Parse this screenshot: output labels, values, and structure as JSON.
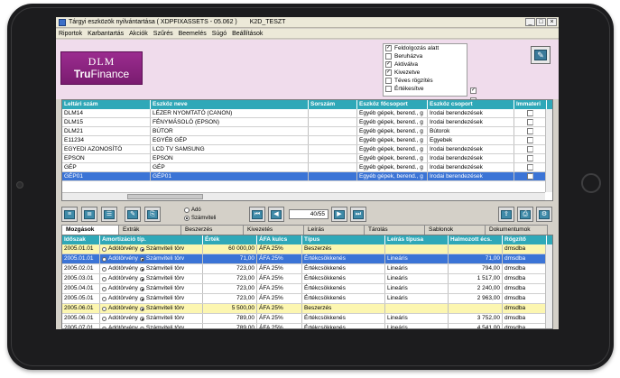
{
  "window": {
    "title": "Tárgyi eszközök nyilvántartása ( XDPFIXASSETS - 05.062 )",
    "user": "K2D_TESZT",
    "minimize": "_",
    "maximize": "□",
    "close": "×"
  },
  "menu": [
    "Riportok",
    "Karbantartás",
    "Akciók",
    "Szűrés",
    "Beemelés",
    "Súgó",
    "Beállítások"
  ],
  "logo": {
    "line1": "DLM",
    "line2a": "Tru",
    "line2b": "Finance"
  },
  "status_checks": [
    {
      "label": "Feldolgozás alatt",
      "checked": true
    },
    {
      "label": "Beruházva",
      "checked": false
    },
    {
      "label": "Aktiválva",
      "checked": true
    },
    {
      "label": "Kivezetve",
      "checked": true
    },
    {
      "label": "Téves rögzítés",
      "checked": false
    },
    {
      "label": "Értékesítve",
      "checked": false
    }
  ],
  "side_checks": [
    {
      "checked": true
    },
    {
      "checked": false
    }
  ],
  "assets_grid": {
    "columns": [
      "Leltári szám",
      "Eszköz neve",
      "Sorszám",
      "Eszköz főcsoport",
      "Eszköz csoport",
      "Immateri"
    ],
    "rows": [
      {
        "inv": "DLM14",
        "name": "LÉZER NYOMTATÓ (CANON)",
        "seq": "",
        "main": "Egyéb gépek, berend., g",
        "group": "Irodai berendezések",
        "imm": false
      },
      {
        "inv": "DLM15",
        "name": "FÉNYMÁSOLÓ (EPSON)",
        "seq": "",
        "main": "Egyéb gépek, berend., g",
        "group": "Irodai berendezések",
        "imm": false
      },
      {
        "inv": "DLM21",
        "name": "BÚTOR",
        "seq": "",
        "main": "Egyéb gépek, berend., g",
        "group": "Bútorok",
        "imm": false
      },
      {
        "inv": "E11234",
        "name": "EGYÉB GÉP",
        "seq": "",
        "main": "Egyéb gépek, berend., g",
        "group": "Egyebek",
        "imm": false
      },
      {
        "inv": "EGYEDI AZONOSÍTÓ",
        "name": "LCD TV SAMSUNG",
        "seq": "",
        "main": "Egyéb gépek, berend., g",
        "group": "Irodai berendezések",
        "imm": false
      },
      {
        "inv": "EPSON",
        "name": "EPSON",
        "seq": "",
        "main": "Egyéb gépek, berend., g",
        "group": "Irodai berendezések",
        "imm": false
      },
      {
        "inv": "GÉP",
        "name": "GÉP",
        "seq": "",
        "main": "Egyéb gépek, berend., g",
        "group": "Irodai berendezések",
        "imm": false
      },
      {
        "inv": "GÉP01",
        "name": "GÉP01",
        "seq": "",
        "main": "Egyéb gépek, berend., g",
        "group": "Irodai berendezések",
        "imm": false,
        "selected": true
      }
    ]
  },
  "radio_mode": {
    "options": [
      "Adó",
      "Számviteli"
    ],
    "selected": 1
  },
  "nav": {
    "counter": "40/55"
  },
  "tabs": [
    "Mozgások",
    "Extrák",
    "Beszerzés",
    "Kivezetés",
    "Leírás",
    "Tárolás",
    "Sablonok",
    "Dokumentumok"
  ],
  "movements_grid": {
    "columns": [
      "Időszak",
      "Amortizáció típ.",
      "Érték",
      "ÁFA kulcs",
      "Típus",
      "Leírás típusa",
      "Halmozott écs.",
      "Rögzítő"
    ],
    "radio_labels": [
      "Adótörvény",
      "Számviteli törv"
    ],
    "rows": [
      {
        "period": "2005.01.01",
        "amort": 1,
        "value": "60 000,00",
        "vat": "ÁFA 25%",
        "type": "Beszerzés",
        "method": "",
        "acc": "",
        "rec": "dmsdba",
        "style": "yellow"
      },
      {
        "period": "2005.01.01",
        "amort": 1,
        "value": "71,00",
        "vat": "ÁFA 25%",
        "type": "Értékcsökkenés",
        "method": "Lineáris",
        "acc": "71,00",
        "rec": "dmsdba",
        "style": "sel"
      },
      {
        "period": "2005.02.01",
        "amort": 1,
        "value": "723,00",
        "vat": "ÁFA 25%",
        "type": "Értékcsökkenés",
        "method": "Lineáris",
        "acc": "794,00",
        "rec": "dmsdba",
        "style": ""
      },
      {
        "period": "2005.03.01",
        "amort": 1,
        "value": "723,00",
        "vat": "ÁFA 25%",
        "type": "Értékcsökkenés",
        "method": "Lineáris",
        "acc": "1 517,00",
        "rec": "dmsdba",
        "style": ""
      },
      {
        "period": "2005.04.01",
        "amort": 1,
        "value": "723,00",
        "vat": "ÁFA 25%",
        "type": "Értékcsökkenés",
        "method": "Lineáris",
        "acc": "2 240,00",
        "rec": "dmsdba",
        "style": ""
      },
      {
        "period": "2005.05.01",
        "amort": 1,
        "value": "723,00",
        "vat": "ÁFA 25%",
        "type": "Értékcsökkenés",
        "method": "Lineáris",
        "acc": "2 963,00",
        "rec": "dmsdba",
        "style": ""
      },
      {
        "period": "2005.06.01",
        "amort": 1,
        "value": "5 500,00",
        "vat": "ÁFA 25%",
        "type": "Beszerzés",
        "method": "",
        "acc": "",
        "rec": "dmsdba",
        "style": "yellow"
      },
      {
        "period": "2005.06.01",
        "amort": 1,
        "value": "789,00",
        "vat": "ÁFA 25%",
        "type": "Értékcsökkenés",
        "method": "Lineáris",
        "acc": "3 752,00",
        "rec": "dmsdba",
        "style": ""
      },
      {
        "period": "2005.07.01",
        "amort": 1,
        "value": "789,00",
        "vat": "ÁFA 25%",
        "type": "Értékcsökkenés",
        "method": "Lineáris",
        "acc": "4 541,00",
        "rec": "dmsdba",
        "style": ""
      }
    ]
  },
  "colors": {
    "accent_header": "#2fa8b8",
    "selection": "#3b74d6",
    "header_panel": "#f0dcec",
    "logo": "#8a2480",
    "highlight_row": "#fcf6b0"
  }
}
